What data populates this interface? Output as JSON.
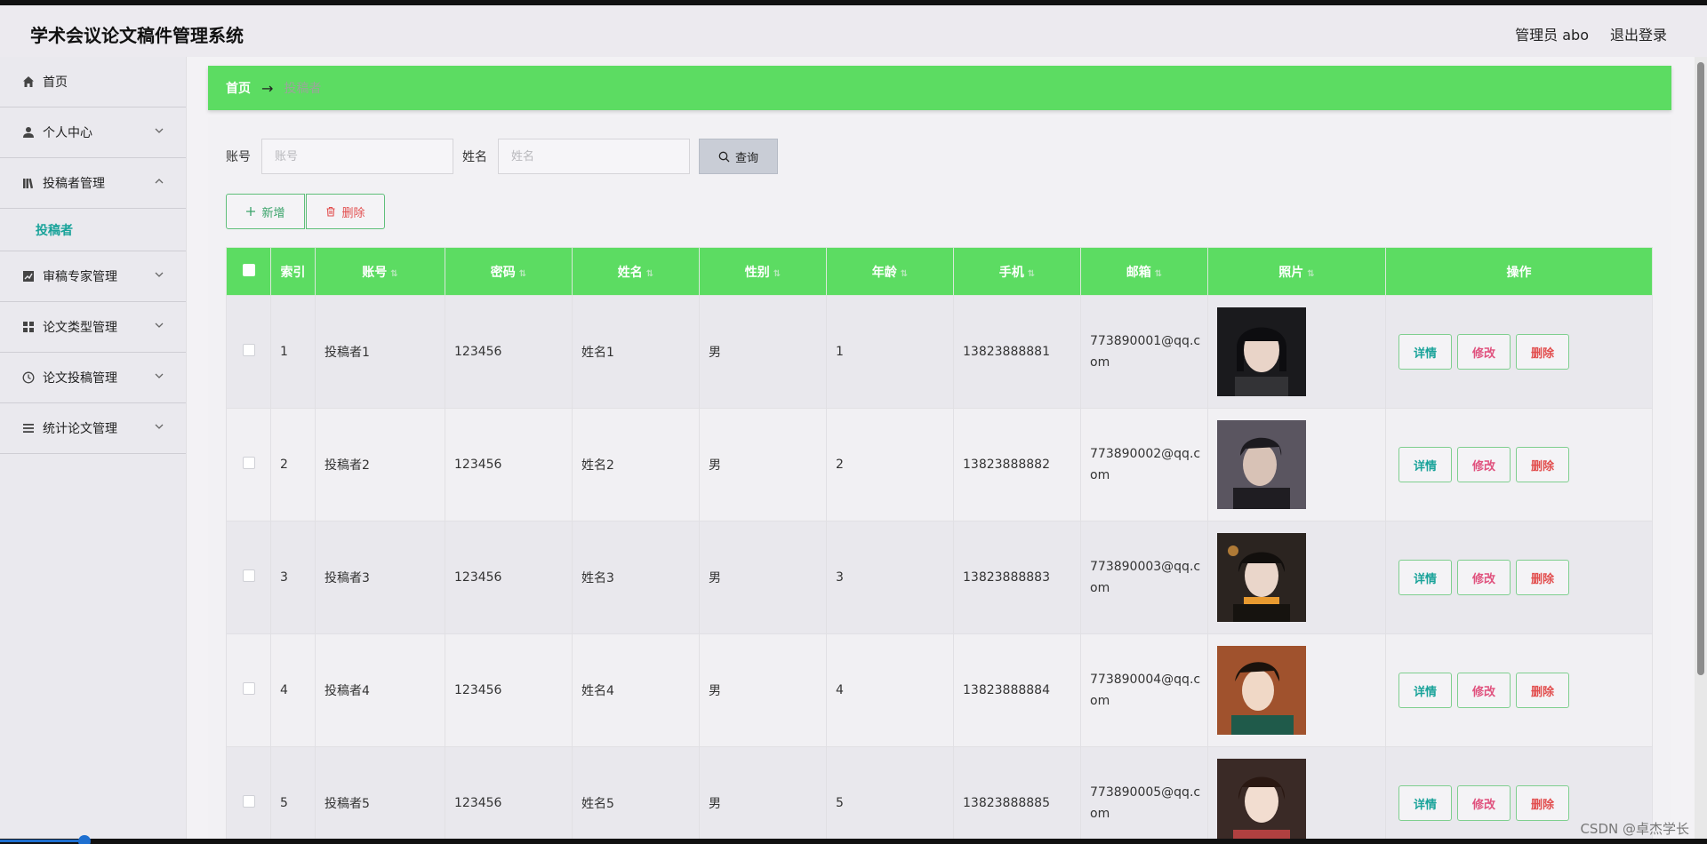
{
  "header": {
    "app_title": "学术会议论文稿件管理系统",
    "user_label": "管理员 abo",
    "logout_label": "退出登录"
  },
  "sidebar": {
    "items": [
      {
        "label": "首页",
        "icon": "home-icon",
        "expandable": false
      },
      {
        "label": "个人中心",
        "icon": "user-icon",
        "expandable": true
      },
      {
        "label": "投稿者管理",
        "icon": "library-icon",
        "expandable": true,
        "expanded": true
      },
      {
        "label": "审稿专家管理",
        "icon": "chart-icon",
        "expandable": true
      },
      {
        "label": "论文类型管理",
        "icon": "grid-icon",
        "expandable": true
      },
      {
        "label": "论文投稿管理",
        "icon": "clock-icon",
        "expandable": true
      },
      {
        "label": "统计论文管理",
        "icon": "list-icon",
        "expandable": true
      }
    ],
    "submenu": {
      "label": "投稿者",
      "color": "#1aa39a"
    }
  },
  "breadcrumb": {
    "home": "首页",
    "arrow": "→",
    "current": "投稿者"
  },
  "search": {
    "account_label": "账号",
    "account_placeholder": "账号",
    "name_label": "姓名",
    "name_placeholder": "姓名",
    "query_label": "查询"
  },
  "actions": {
    "add_label": "新增",
    "delete_label": "删除"
  },
  "table": {
    "columns": [
      "索引",
      "账号",
      "密码",
      "姓名",
      "性别",
      "年龄",
      "手机",
      "邮箱",
      "照片",
      "操作"
    ],
    "rows": [
      {
        "index": "1",
        "account": "投稿者1",
        "password": "123456",
        "name": "姓名1",
        "gender": "男",
        "age": "1",
        "phone": "13823888881",
        "email": "773890001@qq.com"
      },
      {
        "index": "2",
        "account": "投稿者2",
        "password": "123456",
        "name": "姓名2",
        "gender": "男",
        "age": "2",
        "phone": "13823888882",
        "email": "773890002@qq.com"
      },
      {
        "index": "3",
        "account": "投稿者3",
        "password": "123456",
        "name": "姓名3",
        "gender": "男",
        "age": "3",
        "phone": "13823888883",
        "email": "773890003@qq.com"
      },
      {
        "index": "4",
        "account": "投稿者4",
        "password": "123456",
        "name": "姓名4",
        "gender": "男",
        "age": "4",
        "phone": "13823888884",
        "email": "773890004@qq.com"
      },
      {
        "index": "5",
        "account": "投稿者5",
        "password": "123456",
        "name": "姓名5",
        "gender": "男",
        "age": "5",
        "phone": "13823888885",
        "email": "773890005@qq.com"
      }
    ],
    "row_actions": {
      "detail": "详情",
      "edit": "修改",
      "remove": "删除"
    }
  },
  "watermark": "CSDN @卓杰学长",
  "colors": {
    "accent_green": "#5cdc62",
    "teal": "#1aa39a",
    "danger": "#e24e4e",
    "pink": "#e0527e"
  }
}
